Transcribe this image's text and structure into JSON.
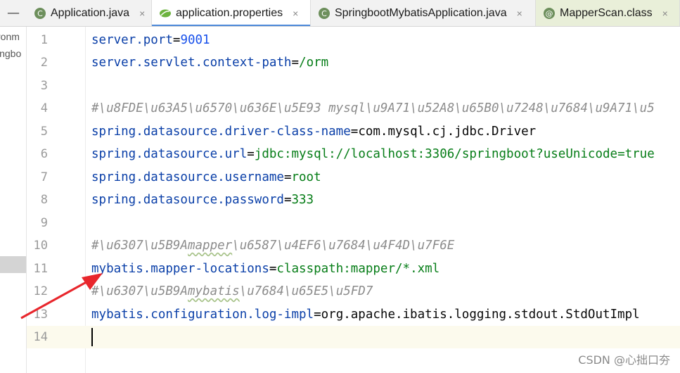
{
  "tabs": [
    {
      "label": "Application.java",
      "icon": "spring-class-icon",
      "active": false
    },
    {
      "label": "application.properties",
      "icon": "spring-leaf-icon",
      "active": true
    },
    {
      "label": "SpringbootMybatisApplication.java",
      "icon": "spring-class-icon",
      "active": false
    },
    {
      "label": "MapperScan.class",
      "icon": "annotation-icon",
      "active": false
    }
  ],
  "tab_close_glyph": "×",
  "collapse_glyph": "—",
  "project": {
    "items": [
      "ronm",
      "ingbo"
    ]
  },
  "lines": [
    {
      "n": "1",
      "text": "server.port=9001"
    },
    {
      "n": "2",
      "text": "server.servlet.context-path=/orm"
    },
    {
      "n": "3",
      "text": ""
    },
    {
      "n": "4",
      "text": "#\\u8FDE\\u63A5\\u6570\\u636E\\u5E93 mysql\\u9A71\\u52A8\\u65B0\\u7248\\u7684\\u9A71\\u5"
    },
    {
      "n": "5",
      "text": "spring.datasource.driver-class-name=com.mysql.cj.jdbc.Driver"
    },
    {
      "n": "6",
      "text": "spring.datasource.url=jdbc:mysql://localhost:3306/springboot?useUnicode=true"
    },
    {
      "n": "7",
      "text": "spring.datasource.username=root"
    },
    {
      "n": "8",
      "text": "spring.datasource.password=333"
    },
    {
      "n": "9",
      "text": ""
    },
    {
      "n": "10",
      "text": "#\\u6307\\u5B9Amapper\\u6587\\u4EF6\\u7684\\u4F4D\\u7F6E"
    },
    {
      "n": "11",
      "text": "mybatis.mapper-locations=classpath:mapper/*.xml"
    },
    {
      "n": "12",
      "text": "#\\u6307\\u5B9Amybatis\\u7684\\u65E5\\u5FD7"
    },
    {
      "n": "13",
      "text": "mybatis.configuration.log-impl=org.apache.ibatis.logging.stdout.StdOutImpl"
    },
    {
      "n": "14",
      "text": ""
    }
  ],
  "code_parts": {
    "l1": {
      "k": "server.port",
      "eq": "=",
      "v": "9001"
    },
    "l2": {
      "k": "server.servlet.context-path",
      "eq": "=",
      "v": "/orm"
    },
    "l4": {
      "c": "#\\u8FDE\\u63A5\\u6570\\u636E\\u5E93 mysql\\u9A71\\u52A8\\u65B0\\u7248\\u7684\\u9A71\\u5"
    },
    "l5": {
      "k": "spring.datasource.driver-class-name",
      "eq": "=",
      "v": "com.mysql.cj.jdbc.Driver"
    },
    "l6": {
      "k": "spring.datasource.url",
      "eq": "=",
      "v": "jdbc:mysql://localhost:3306/springboot?useUnicode=true"
    },
    "l7": {
      "k": "spring.datasource.username",
      "eq": "=",
      "v": "root"
    },
    "l8": {
      "k": "spring.datasource.password",
      "eq": "=",
      "v": "333"
    },
    "l10": {
      "c1": "#\\u6307\\u5B9A",
      "c2": "mapper",
      "c3": "\\u6587\\u4EF6\\u7684\\u4F4D\\u7F6E"
    },
    "l11": {
      "k": "mybatis.mapper-locations",
      "eq": "=",
      "v": "classpath:mapper/*.xml"
    },
    "l12": {
      "c1": "#\\u6307\\u5B9A",
      "c2": "mybatis",
      "c3": "\\u7684\\u65E5\\u5FD7"
    },
    "l13": {
      "k": "mybatis.configuration.log-impl",
      "eq": "=",
      "v": "org.apache.ibatis.logging.stdout.StdOutImpl"
    }
  },
  "watermark": "CSDN @心拙口夯",
  "colors": {
    "key": "#0a3fa8",
    "value": "#067d17",
    "number": "#1750eb",
    "comment": "#8c8c8c",
    "arrow": "#e8262c",
    "active_tab_underline": "#4a88d9"
  }
}
